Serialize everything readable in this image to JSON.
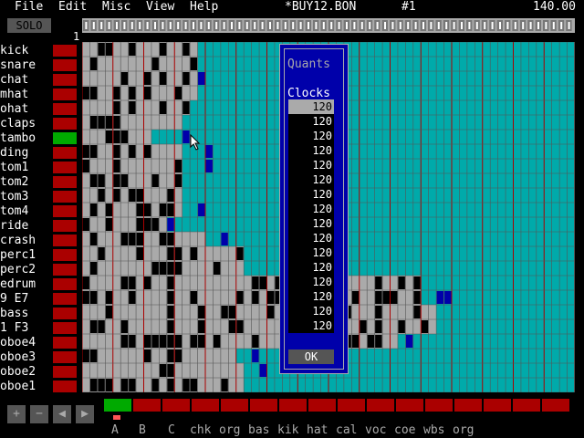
{
  "menu": {
    "items": [
      "File",
      "Edit",
      "Misc",
      "View",
      "Help"
    ],
    "song": "*BUY12.BON",
    "pattern": "#1",
    "tempo": "140.00"
  },
  "solo_label": "SOLO",
  "ruler_number": "1",
  "tracks": [
    {
      "name": "kick",
      "button": "off"
    },
    {
      "name": "snare",
      "button": "off"
    },
    {
      "name": "chat",
      "button": "off"
    },
    {
      "name": "mhat",
      "button": "off"
    },
    {
      "name": "ohat",
      "button": "off"
    },
    {
      "name": "claps",
      "button": "off"
    },
    {
      "name": "tambo",
      "button": "on"
    },
    {
      "name": "ding",
      "button": "off"
    },
    {
      "name": "tom1",
      "button": "off"
    },
    {
      "name": "tom2",
      "button": "off"
    },
    {
      "name": "tom3",
      "button": "off"
    },
    {
      "name": "tom4",
      "button": "off"
    },
    {
      "name": "ride",
      "button": "off"
    },
    {
      "name": "crash",
      "button": "off"
    },
    {
      "name": "perc1",
      "button": "off"
    },
    {
      "name": "perc2",
      "button": "off"
    },
    {
      "name": "edrum",
      "button": "off"
    },
    {
      "name": "9 E7",
      "button": "off"
    },
    {
      "name": "bass",
      "button": "off"
    },
    {
      "name": "1 F3",
      "button": "off"
    },
    {
      "name": "oboe4",
      "button": "off"
    },
    {
      "name": "oboe3",
      "button": "off"
    },
    {
      "name": "oboe2",
      "button": "off"
    },
    {
      "name": "oboe1",
      "button": "off"
    }
  ],
  "quants_dialog": {
    "title": "Quants",
    "clocks_label": "Clocks",
    "values": [
      "120",
      "120",
      "120",
      "120",
      "120",
      "120",
      "120",
      "120",
      "120",
      "120",
      "120",
      "120",
      "120",
      "120",
      "120",
      "120"
    ],
    "selected_index": 0,
    "ok_label": "OK"
  },
  "transport": {
    "buttons": [
      "+",
      "−",
      "◀",
      "▶"
    ]
  },
  "pattern_buttons": [
    "on",
    "off",
    "off",
    "off",
    "off",
    "off",
    "off",
    "off",
    "off",
    "off",
    "off",
    "off",
    "off",
    "off",
    "off",
    "off"
  ],
  "pattern_labels": [
    "A",
    "B",
    "C",
    "chk",
    "org",
    "bas",
    "kik",
    "hat",
    "cal",
    "voc",
    "coe",
    "wbs",
    "org"
  ],
  "colors": {
    "grid_gray": "#aaaaaa",
    "grid_teal": "#00aaaa",
    "note_black": "#000000",
    "note_blue": "#0000aa",
    "grid_line": "#aa0000",
    "dialog_blue": "#0000aa",
    "button_red": "#aa0000",
    "button_green": "#00aa00"
  }
}
